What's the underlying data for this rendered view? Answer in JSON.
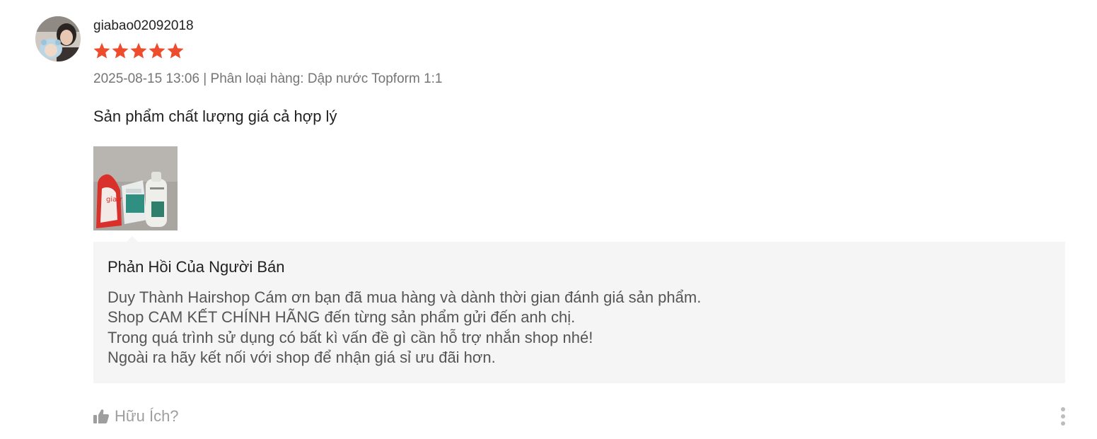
{
  "review": {
    "username": "giabao02092018",
    "rating": 5,
    "rating_max": 5,
    "star_color": "#ee4d2d",
    "timestamp": "2025-08-15 13:06",
    "separator": " | ",
    "variation_prefix": "Phân loại hàng: ",
    "variation": "Dập nước Topform 1:1",
    "text": "Sản phẩm chất lượng giá cả hợp lý",
    "photos": [
      {
        "icon": "product-photo-thumbnail"
      }
    ],
    "avatar_icon": "user-avatar"
  },
  "seller_reply": {
    "title": "Phản Hồi Của Người Bán",
    "lines": [
      "Duy Thành Hairshop Cám ơn bạn đã mua hàng và dành thời gian đánh giá sản phẩm.",
      "Shop CAM KẾT CHÍNH HÃNG đến từng sản phẩm gửi đến anh chị.",
      "Trong quá trình sử dụng có bất kì vấn đề gì cần hỗ trợ nhắn shop nhé!",
      "Ngoài ra hãy kết nối với shop để nhận giá sỉ ưu đãi hơn."
    ],
    "background": "#f5f5f5"
  },
  "actions": {
    "helpful_label": "Hữu Ích?",
    "helpful_icon": "thumbs-up-icon",
    "more_icon": "more-vertical-icon"
  }
}
